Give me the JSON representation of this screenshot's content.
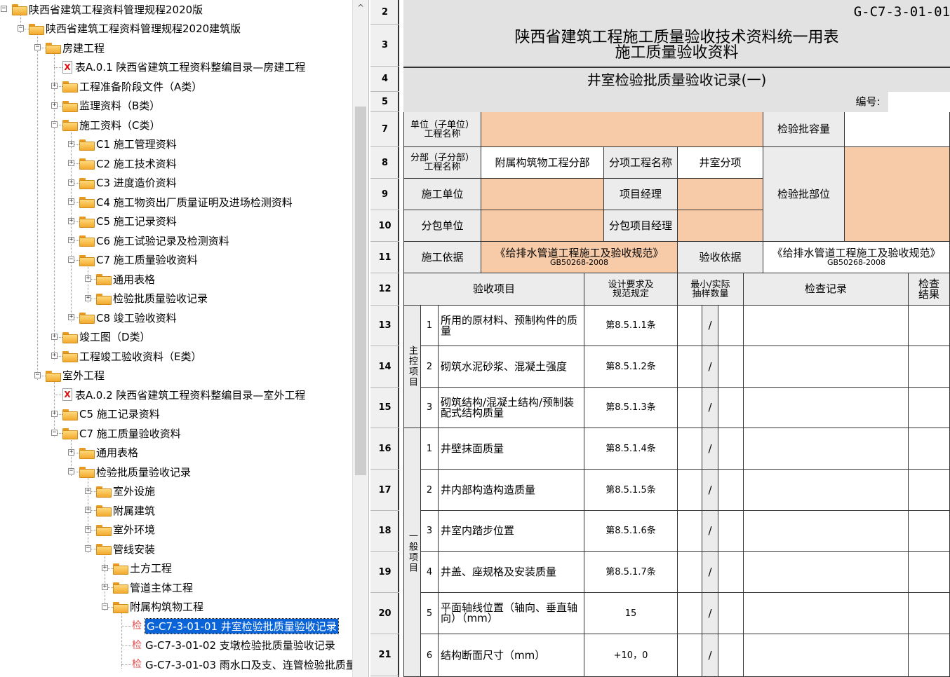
{
  "tree": {
    "nodes": [
      {
        "label": "陕西省建筑工程资料管理规程2020版",
        "icon": "folder-open-icon",
        "box": "minus"
      },
      {
        "label": "陕西省建筑工程资料管理规程2020建筑版",
        "icon": "folder-open-icon",
        "box": "minus"
      },
      {
        "label": "房建工程",
        "icon": "folder-open-icon",
        "box": "minus"
      },
      {
        "label": "表A.0.1 陕西省建筑工程资料整编目录—房建工程",
        "icon": "pdf-file-icon",
        "box": ""
      },
      {
        "label": "工程准备阶段文件（A类）",
        "icon": "folder-icon",
        "box": "plus"
      },
      {
        "label": "监理资料（B类）",
        "icon": "folder-icon",
        "box": "plus"
      },
      {
        "label": "施工资料（C类）",
        "icon": "folder-open-icon",
        "box": "minus"
      },
      {
        "label": "C1 施工管理资料",
        "icon": "folder-icon",
        "box": "plus"
      },
      {
        "label": "C2 施工技术资料",
        "icon": "folder-icon",
        "box": "plus"
      },
      {
        "label": "C3 进度造价资料",
        "icon": "folder-icon",
        "box": "plus"
      },
      {
        "label": "C4 施工物资出厂质量证明及进场检测资料",
        "icon": "folder-icon",
        "box": "plus"
      },
      {
        "label": "C5 施工记录资料",
        "icon": "folder-icon",
        "box": "plus"
      },
      {
        "label": "C6 施工试验记录及检测资料",
        "icon": "folder-icon",
        "box": "plus"
      },
      {
        "label": "C7 施工质量验收资料",
        "icon": "folder-open-icon",
        "box": "minus"
      },
      {
        "label": "通用表格",
        "icon": "folder-icon",
        "box": "plus"
      },
      {
        "label": "检验批质量验收记录",
        "icon": "folder-icon",
        "box": "plus"
      },
      {
        "label": "C8 竣工验收资料",
        "icon": "folder-icon",
        "box": "plus"
      },
      {
        "label": "竣工图（D类）",
        "icon": "folder-icon",
        "box": "plus"
      },
      {
        "label": "工程竣工验收资料（E类）",
        "icon": "folder-icon",
        "box": "plus"
      },
      {
        "label": "室外工程",
        "icon": "folder-open-icon",
        "box": "minus"
      },
      {
        "label": "表A.0.2 陕西省建筑工程资料整编目录—室外工程",
        "icon": "pdf-file-icon",
        "box": ""
      },
      {
        "label": "C5 施工记录资料",
        "icon": "folder-icon",
        "box": "plus"
      },
      {
        "label": "C7 施工质量验收资料",
        "icon": "folder-open-icon",
        "box": "minus"
      },
      {
        "label": "通用表格",
        "icon": "folder-icon",
        "box": "plus"
      },
      {
        "label": "检验批质量验收记录",
        "icon": "folder-open-icon",
        "box": "minus"
      },
      {
        "label": "室外设施",
        "icon": "folder-icon",
        "box": "plus"
      },
      {
        "label": "附属建筑",
        "icon": "folder-icon",
        "box": "plus"
      },
      {
        "label": "室外环境",
        "icon": "folder-icon",
        "box": "plus"
      },
      {
        "label": "管线安装",
        "icon": "folder-open-icon",
        "box": "minus"
      },
      {
        "label": "土方工程",
        "icon": "folder-icon",
        "box": "plus"
      },
      {
        "label": "管道主体工程",
        "icon": "folder-icon",
        "box": "plus"
      },
      {
        "label": "附属构筑物工程",
        "icon": "folder-open-icon",
        "box": "minus"
      },
      {
        "label": "G-C7-3-01-01 井室检验批质量验收记录",
        "icon": "jian-icon",
        "box": "",
        "selected": true
      },
      {
        "label": "G-C7-3-01-02 支墩检验批质量验收记录",
        "icon": "jian-icon",
        "box": ""
      },
      {
        "label": "G-C7-3-01-03 雨水口及支、连管检验批质量",
        "icon": "jian-icon",
        "box": ""
      }
    ],
    "jian_glyph": "检",
    "pdf_glyph": "X",
    "scroll_up_glyph": "^"
  },
  "sheet": {
    "rows": [
      "2",
      "3",
      "4",
      "5",
      "7",
      "8",
      "9",
      "10",
      "11",
      "12",
      "13",
      "14",
      "15",
      "16",
      "17",
      "18",
      "19",
      "20",
      "21"
    ],
    "form_code": "G-C7-3-01-01",
    "title_line1": "陕西省建筑工程施工质量验收技术资料统一用表",
    "title_line2": "施工质量验收资料",
    "subtitle": "井室检验批质量验收记录(一)",
    "number_label": "编号:",
    "unit_label": "单位（子单位）\n工程名称",
    "capacity_label": "检验批容量",
    "division_label": "分部（子分部）\n工程名称",
    "division_value": "附属构筑物工程分部",
    "item_label": "分项工程名称",
    "item_value": "井室分项",
    "location_label": "检验批部位",
    "contractor_label": "施工单位",
    "pm_label": "项目经理",
    "sub_label": "分包单位",
    "sub_pm_label": "分包项目经理",
    "basis_label": "施工依据",
    "basis_value_line1": "《给排水管道工程施工及验收规范》",
    "basis_value_line2": "GB50268-2008",
    "accept_basis_label": "验收依据",
    "accept_value_line1": "《给排水管道工程施工及验收规范》",
    "accept_value_line2": "GB50268-2008",
    "header_item": "验收项目",
    "header_design": "设计要求及\n规范规定",
    "header_sample": "最小/实际\n抽样数量",
    "header_record": "检查记录",
    "header_result": "检查\n结果",
    "main_group_label": "主控项目",
    "general_group_label": "一般项目",
    "main_items": [
      {
        "no": "1",
        "name": "所用的原材料、预制构件的质\n量",
        "spec": "第8.5.1.1条",
        "slash": "/"
      },
      {
        "no": "2",
        "name": "砌筑水泥砂浆、混凝土强度",
        "spec": "第8.5.1.2条",
        "slash": "/"
      },
      {
        "no": "3",
        "name": "砌筑结构/混凝土结构/预制装\n配式结构质量",
        "spec": "第8.5.1.3条",
        "slash": "/"
      }
    ],
    "general_items": [
      {
        "no": "1",
        "name": "井壁抹面质量",
        "spec": "第8.5.1.4条",
        "slash": "/"
      },
      {
        "no": "2",
        "name": "井内部构造构造质量",
        "spec": "第8.5.1.5条",
        "slash": "/"
      },
      {
        "no": "3",
        "name": "井室内踏步位置",
        "spec": "第8.5.1.6条",
        "slash": "/"
      },
      {
        "no": "4",
        "name": "井盖、座规格及安装质量",
        "spec": "第8.5.1.7条",
        "slash": "/"
      },
      {
        "no": "5",
        "name": "平面轴线位置（轴向、垂直轴\n向）（mm）",
        "spec": "15",
        "slash": "/"
      },
      {
        "no": "6",
        "name": "结构断面尺寸（mm）",
        "spec": "+10，0",
        "slash": "/"
      }
    ]
  }
}
